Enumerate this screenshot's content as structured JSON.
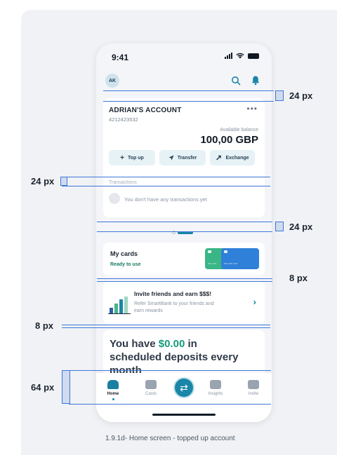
{
  "status_bar": {
    "time": "9:41"
  },
  "header": {
    "avatar_initials": "AK",
    "search_icon": "search-icon",
    "bell_icon": "bell-icon"
  },
  "account": {
    "name": "ADRIAN'S ACCOUNT",
    "number": "4212423532",
    "balance_label": "Available balance",
    "balance": "100,00 GBP",
    "actions": [
      {
        "label": "Top up",
        "icon": "plus-icon"
      },
      {
        "label": "Transfer",
        "icon": "send-icon"
      },
      {
        "label": "Exchange",
        "icon": "exchange-icon"
      }
    ],
    "transactions_label": "Transactions",
    "empty_state": "You don't have any transactions yet"
  },
  "pager": {
    "total": 2,
    "active": 2
  },
  "my_cards": {
    "title": "My cards",
    "subtitle": "Ready to use"
  },
  "invite": {
    "title": "Invite friends and earn $$$!",
    "description": "Refer SmartBank to your friends and earn rewards"
  },
  "deposit": {
    "prefix": "You have",
    "amount": "$0.00",
    "suffix": "in scheduled deposits every month"
  },
  "bottom_nav": {
    "items": [
      {
        "label": "Home",
        "icon": "home-icon",
        "active": true
      },
      {
        "label": "Cards",
        "icon": "wallet-icon"
      },
      {
        "label": "Insights",
        "icon": "insights-icon"
      },
      {
        "label": "Invite",
        "icon": "gift-icon"
      }
    ],
    "center_button_icon": "transfer-arrows-icon"
  },
  "annotations": {
    "spacing_24_a": "24 px",
    "spacing_24_b": "24 px",
    "spacing_24_c": "24 px",
    "spacing_8_a": "8 px",
    "spacing_8_b": "8 px",
    "spacing_64": "64 px"
  },
  "caption": "1.9.1d- Home screen - topped up account",
  "colors": {
    "accent": "#1a86a8",
    "success": "#169a7c",
    "annotation": "#3d77d9"
  }
}
